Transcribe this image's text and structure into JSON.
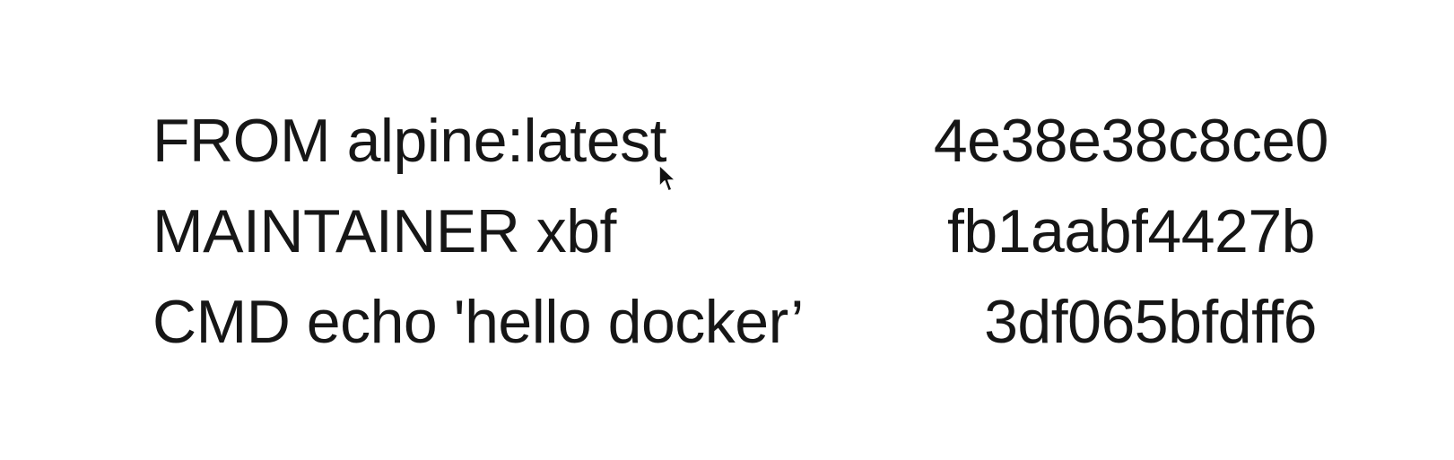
{
  "dockerfile": {
    "rows": [
      {
        "instruction": "FROM alpine:latest",
        "layer_id": "4e38e38c8ce0"
      },
      {
        "instruction": "MAINTAINER xbf",
        "layer_id": "fb1aabf4427b"
      },
      {
        "instruction": "CMD echo 'hello docker’",
        "layer_id": "3df065bfdff6"
      }
    ]
  },
  "cursor": {
    "icon": "arrow-cursor-icon"
  }
}
